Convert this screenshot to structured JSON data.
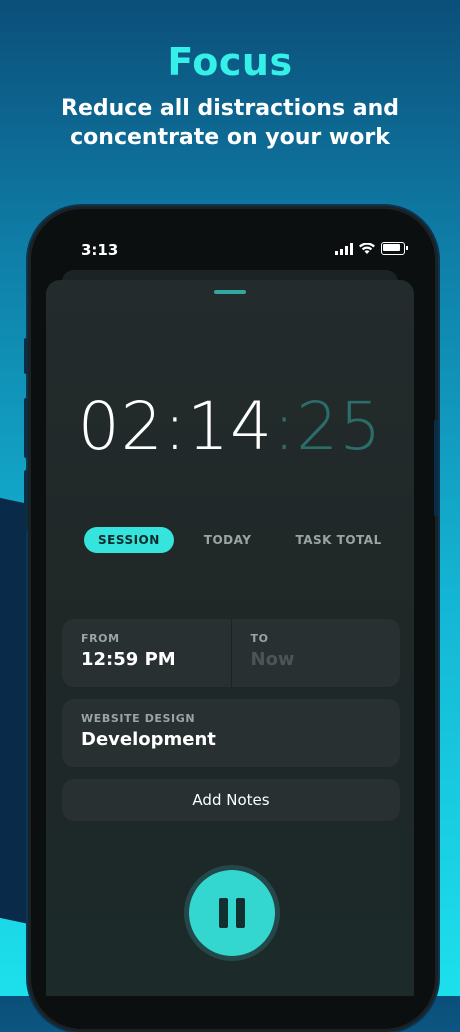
{
  "header": {
    "title": "Focus",
    "subtitle": "Reduce all distractions and concentrate on your work"
  },
  "status_bar": {
    "time": "3:13",
    "icons": [
      "signal-icon",
      "wifi-icon",
      "battery-icon"
    ]
  },
  "timer": {
    "hours": "02",
    "minutes": "14",
    "seconds": "25"
  },
  "tabs": [
    {
      "label": "SESSION",
      "active": true
    },
    {
      "label": "TODAY",
      "active": false
    },
    {
      "label": "TASK TOTAL",
      "active": false
    }
  ],
  "from": {
    "label": "FROM",
    "value": "12:59 PM"
  },
  "to": {
    "label": "TO",
    "value": "Now"
  },
  "task": {
    "project": "WEBSITE DESIGN",
    "name": "Development"
  },
  "notes": {
    "label": "Add Notes"
  },
  "colors": {
    "accent": "#34d7cf",
    "title": "#34f0e8",
    "sheet": "#242b2c",
    "card": "#283031"
  }
}
